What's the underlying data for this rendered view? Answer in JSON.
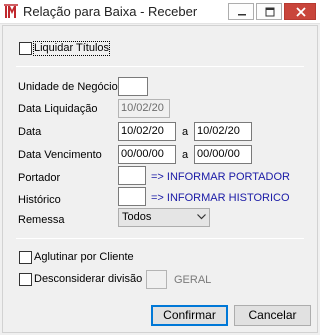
{
  "window": {
    "title": "Relação para Baixa - Receber",
    "close_color": "#c9453b"
  },
  "options": {
    "liquidar_label": "Liquidar Títulos",
    "aglutinar_label": "Aglutinar por Cliente",
    "desconsiderar_label": "Desconsiderar divisão",
    "geral_label": "GERAL"
  },
  "form": {
    "unidade_label": "Unidade de Negócio",
    "unidade_value": "",
    "data_liquidacao_label": "Data Liquidação",
    "data_liquidacao_value": "10/02/20",
    "data_label": "Data",
    "data_from": "10/02/20",
    "data_sep": "a",
    "data_to": "10/02/20",
    "vencimento_label": "Data Vencimento",
    "vencimento_from": "00/00/00",
    "vencimento_sep": "a",
    "vencimento_to": "00/00/00",
    "portador_label": "Portador",
    "portador_value": "",
    "portador_hint": "=> INFORMAR PORTADOR",
    "historico_label": "Histórico",
    "historico_value": "",
    "historico_hint": "=> INFORMAR HISTORICO",
    "remessa_label": "Remessa",
    "remessa_value": "Todos",
    "divisao_value": ""
  },
  "buttons": {
    "confirmar": "Confirmar",
    "cancelar": "Cancelar"
  },
  "colors": {
    "hint_text": "#1a1aa6",
    "default_button_border": "#0078d7"
  }
}
